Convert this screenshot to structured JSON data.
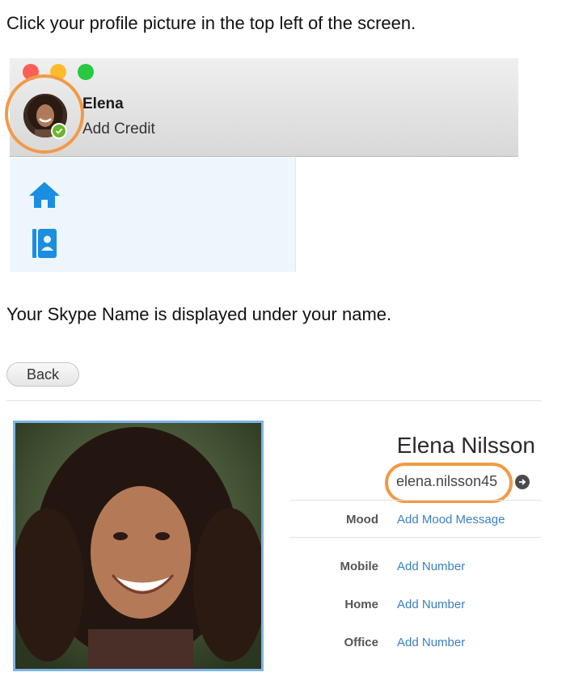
{
  "instructions": {
    "step1": "Click your profile picture in the top left of the screen.",
    "step2": "Your Skype Name is displayed under your name."
  },
  "titlebar": {
    "profile_name": "Elena",
    "add_credit": "Add Credit",
    "status": "online"
  },
  "sidebar": {
    "icons": [
      "home-icon",
      "contacts-icon"
    ]
  },
  "profile": {
    "back_label": "Back",
    "full_name": "Elena Nilsson",
    "skype_name": "elena.nilsson45",
    "fields": [
      {
        "label": "Mood",
        "value": "Add Mood Message"
      },
      {
        "label": "Mobile",
        "value": "Add Number"
      },
      {
        "label": "Home",
        "value": "Add Number"
      },
      {
        "label": "Office",
        "value": "Add Number"
      }
    ]
  },
  "colors": {
    "highlight_ring": "#f29a45",
    "link": "#3a7fc2",
    "accent_blue": "#1a8ee1",
    "status_green": "#6ab52f"
  }
}
